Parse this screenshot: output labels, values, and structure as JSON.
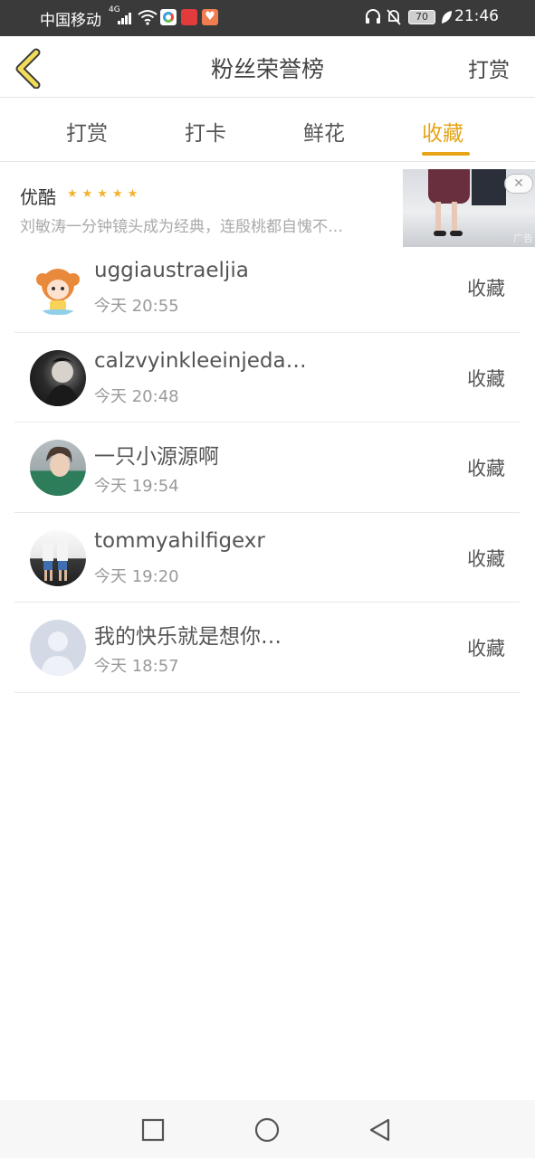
{
  "status_bar": {
    "carrier": "中国移动",
    "network": "4G",
    "battery": "70",
    "time": "21:46"
  },
  "header": {
    "title": "粉丝荣誉榜",
    "right_action": "打赏"
  },
  "tabs": [
    {
      "label": "打赏",
      "active": false
    },
    {
      "label": "打卡",
      "active": false
    },
    {
      "label": "鲜花",
      "active": false
    },
    {
      "label": "收藏",
      "active": true
    }
  ],
  "ad": {
    "source": "优酷",
    "stars": "★★★★★",
    "text": "刘敏涛一分钟镜头成为经典，连殷桃都自愧不…",
    "label": "广告",
    "close": "✕"
  },
  "list": [
    {
      "name": "uggiaustraeljia",
      "time": "今天 20:55",
      "action": "收藏"
    },
    {
      "name": "calzvyinkleeinjeda…",
      "time": "今天 20:48",
      "action": "收藏"
    },
    {
      "name": "一只小源源啊",
      "time": "今天 19:54",
      "action": "收藏"
    },
    {
      "name": "tommyahilfigexr",
      "time": "今天 19:20",
      "action": "收藏"
    },
    {
      "name": "我的快乐就是想你…",
      "time": "今天 18:57",
      "action": "收藏"
    }
  ],
  "colors": {
    "accent": "#e6a416",
    "status_bar": "#3a3a3a",
    "back_arrow": "#f3dc5a"
  },
  "icons": {
    "back": "chevron-left-icon",
    "nav_recent": "square-icon",
    "nav_home": "circle-icon",
    "nav_back": "triangle-back-icon"
  }
}
